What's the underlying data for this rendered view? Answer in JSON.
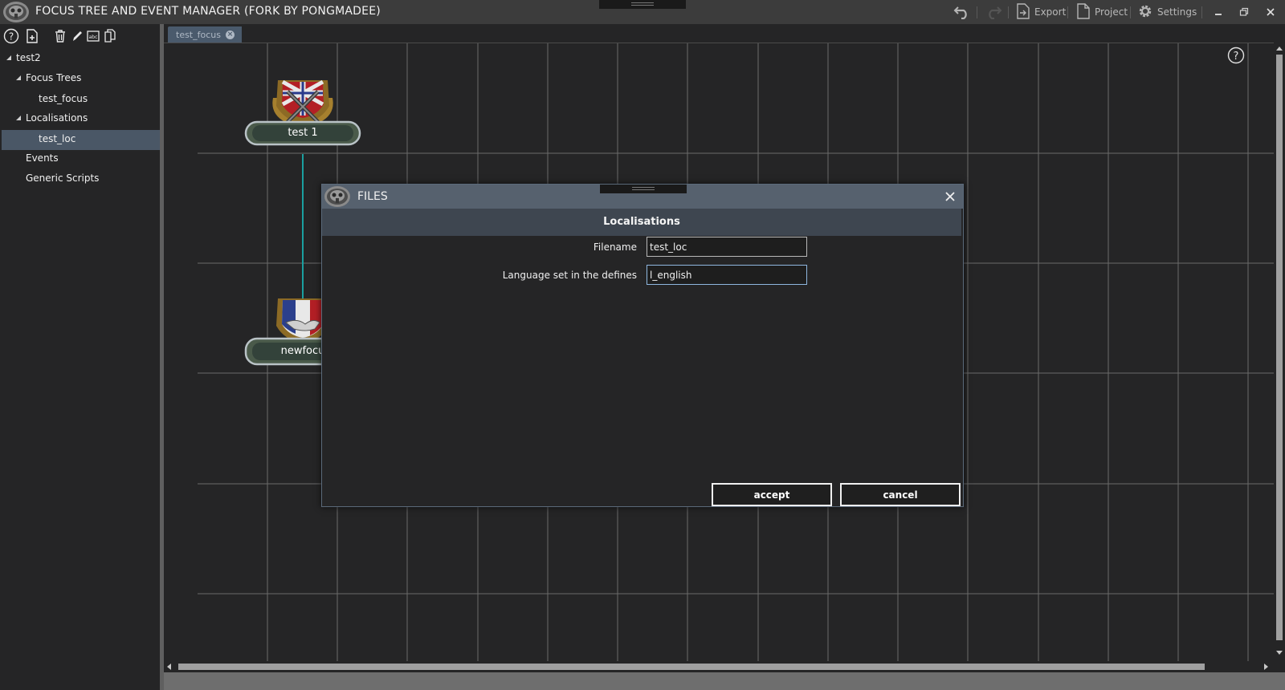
{
  "app": {
    "title": "FOCUS TREE AND EVENT MANAGER (FORK BY PONGMADEE)",
    "logo_icon": "gasmask-emblem-icon"
  },
  "toolbar": {
    "undo_icon": "undo-icon",
    "redo_icon": "redo-icon",
    "export_label": "Export",
    "project_label": "Project",
    "settings_label": "Settings"
  },
  "window_controls": [
    "minimize-icon",
    "restore-icon",
    "close-icon"
  ],
  "left_toolbar": [
    "help-icon",
    "new-file-icon",
    "delete-icon",
    "edit-icon",
    "localisation-icon",
    "duplicate-icon"
  ],
  "tree": {
    "root": "test2",
    "focus_trees": "Focus Trees",
    "focus_tree_item": "test_focus",
    "localisations": "Localisations",
    "localisation_item": "test_loc",
    "events": "Events",
    "generic_scripts": "Generic Scripts"
  },
  "tabs": [
    {
      "label": "test_focus"
    }
  ],
  "canvas": {
    "focuses": [
      {
        "label": "test 1",
        "icon": "british-crossed-rifles-icon"
      },
      {
        "label": "newfocu",
        "icon": "french-handshake-icon"
      }
    ],
    "connector_color": "#1aa0a0",
    "grid_color": "#6a6a6a"
  },
  "dialog": {
    "title": "FILES",
    "heading": "Localisations",
    "fields": {
      "filename_label": "Filename",
      "filename_value": "test_loc",
      "language_label": "Language set in the defines",
      "language_value": "l_english"
    },
    "accept_label": "accept",
    "cancel_label": "cancel"
  },
  "colors": {
    "titlebar": "#3c3c3c",
    "selection": "#4a5766",
    "dialog_titlebar": "#56616e",
    "dialog_header": "#3e4650",
    "tab": "#4a5a6c"
  }
}
